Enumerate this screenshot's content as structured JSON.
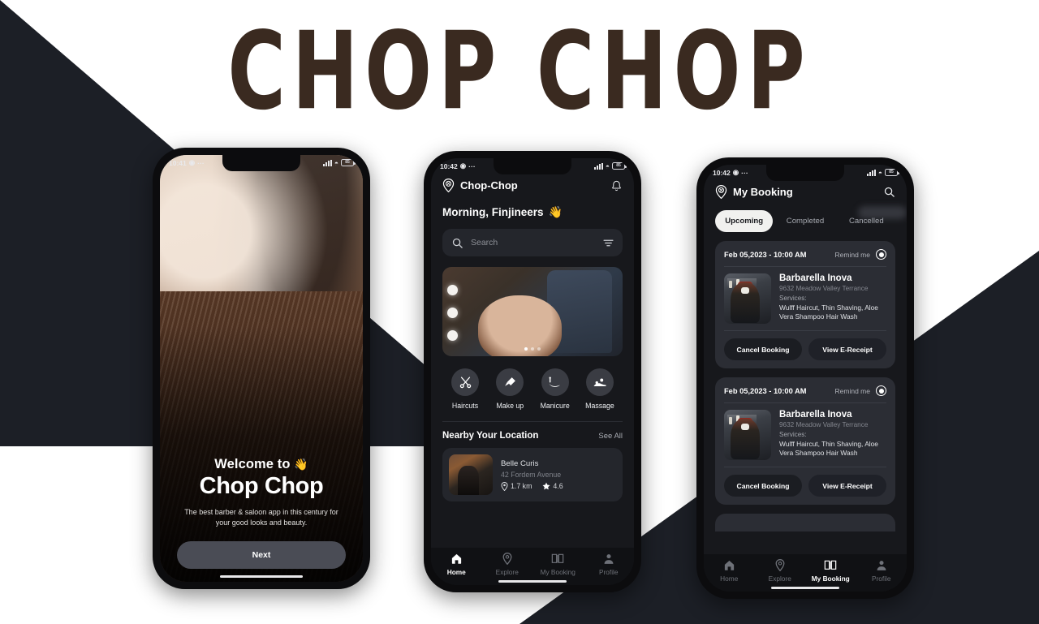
{
  "brand": {
    "title": "CHOP CHOP"
  },
  "theme": {
    "accent": "#3a2a20",
    "dark_bg": "#1c1f26",
    "app_bg": "#17181c",
    "card_bg": "#2b2d34"
  },
  "phone1": {
    "status": {
      "time": "10:41",
      "signal_icon": "signal-icon",
      "wifi_icon": "wifi-icon",
      "battery_icon": "battery-icon"
    },
    "welcome_line": "Welcome to",
    "welcome_emoji": "👋",
    "title": "Chop Chop",
    "subtitle": "The best barber & saloon app in this century for your good looks and beauty.",
    "next_label": "Next"
  },
  "phone2": {
    "status": {
      "time": "10:42"
    },
    "app_name": "Chop-Chop",
    "greeting": "Morning, Finjineers",
    "greeting_emoji": "👋",
    "search": {
      "placeholder": "Search",
      "value": ""
    },
    "banner": {
      "dots": 3,
      "active_dot": 0
    },
    "categories": [
      {
        "label": "Haircuts",
        "icon": "scissors-icon"
      },
      {
        "label": "Make up",
        "icon": "makeup-brush-icon"
      },
      {
        "label": "Manicure",
        "icon": "manicure-hand-icon"
      },
      {
        "label": "Massage",
        "icon": "massage-icon"
      }
    ],
    "nearby": {
      "title": "Nearby Your Location",
      "see_all": "See All",
      "places": [
        {
          "name": "Belle Curis",
          "address": "42 Fordem Avenue",
          "distance": "1.7 km",
          "rating": "4.6"
        }
      ]
    },
    "nav": [
      {
        "label": "Home",
        "icon": "home-icon",
        "active": true
      },
      {
        "label": "Explore",
        "icon": "location-pin-icon",
        "active": false
      },
      {
        "label": "My Booking",
        "icon": "book-icon",
        "active": false
      },
      {
        "label": "Profile",
        "icon": "person-icon",
        "active": false
      }
    ]
  },
  "phone3": {
    "status": {
      "time": "10:42"
    },
    "title": "My Booking",
    "tabs": [
      {
        "label": "Upcoming",
        "active": true
      },
      {
        "label": "Completed",
        "active": false
      },
      {
        "label": "Cancelled",
        "active": false
      }
    ],
    "bookings": [
      {
        "date": "Feb 05,2023 - 10:00 AM",
        "remind_label": "Remind me",
        "remind_on": true,
        "name": "Barbarella Inova",
        "address": "9632 Meadow Valley Terrance",
        "services_label": "Services:",
        "services": "Wulff Haircut, Thin Shaving, Aloe Vera Shampoo Hair Wash",
        "cancel_label": "Cancel Booking",
        "receipt_label": "View E-Receipt"
      },
      {
        "date": "Feb 05,2023 - 10:00 AM",
        "remind_label": "Remind me",
        "remind_on": true,
        "name": "Barbarella Inova",
        "address": "9632 Meadow Valley Terrance",
        "services_label": "Services:",
        "services": "Wulff Haircut, Thin Shaving, Aloe Vera Shampoo Hair Wash",
        "cancel_label": "Cancel Booking",
        "receipt_label": "View E-Receipt"
      }
    ],
    "nav": [
      {
        "label": "Home",
        "icon": "home-icon",
        "active": false
      },
      {
        "label": "Explore",
        "icon": "location-pin-icon",
        "active": false
      },
      {
        "label": "My Booking",
        "icon": "book-icon",
        "active": true
      },
      {
        "label": "Profile",
        "icon": "person-icon",
        "active": false
      }
    ]
  }
}
